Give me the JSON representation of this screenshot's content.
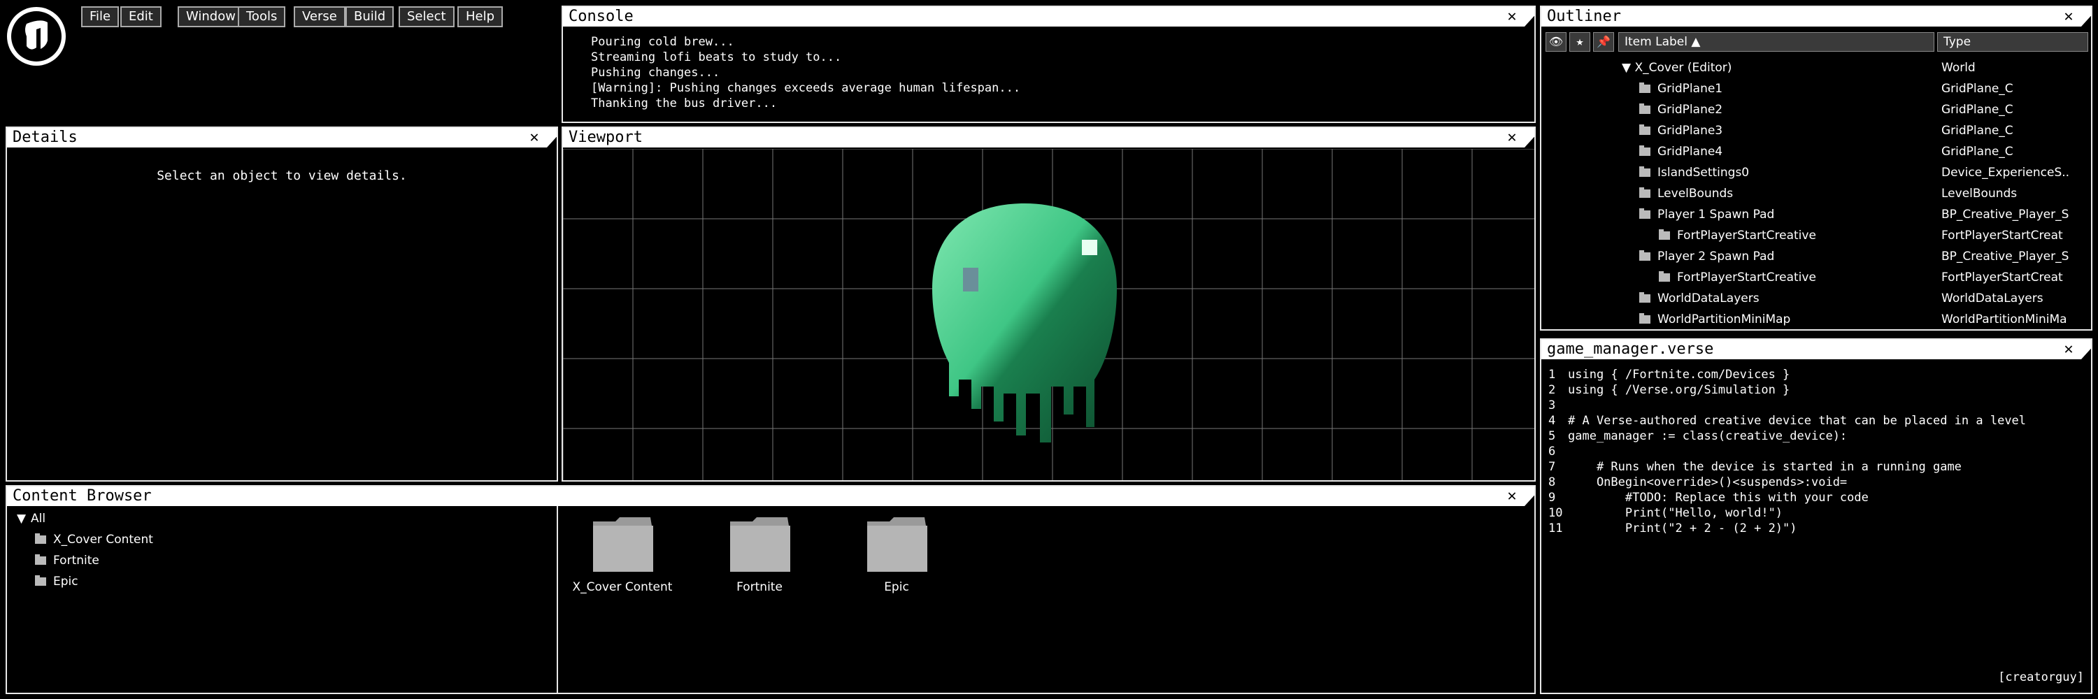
{
  "menu": [
    "File",
    "Edit",
    "Window",
    "Tools",
    "Verse",
    "Build",
    "Select",
    "Help"
  ],
  "console": {
    "title": "Console",
    "lines": [
      "Pouring cold brew...",
      "Streaming lofi beats to study to...",
      "Pushing changes...",
      "[Warning]: Pushing changes exceeds average human lifespan...",
      "Thanking the bus driver..."
    ]
  },
  "details": {
    "title": "Details",
    "empty_text": "Select an object to view details."
  },
  "viewport": {
    "title": "Viewport"
  },
  "outliner": {
    "title": "Outliner",
    "col_label": "Item Label ▲",
    "col_type": "Type",
    "rows": [
      {
        "label": "X_Cover (Editor)",
        "type": "World",
        "indent": 0,
        "expand": true
      },
      {
        "label": "GridPlane1",
        "type": "GridPlane_C",
        "indent": 1
      },
      {
        "label": "GridPlane2",
        "type": "GridPlane_C",
        "indent": 1
      },
      {
        "label": "GridPlane3",
        "type": "GridPlane_C",
        "indent": 1
      },
      {
        "label": "GridPlane4",
        "type": "GridPlane_C",
        "indent": 1
      },
      {
        "label": "IslandSettings0",
        "type": "Device_ExperienceS..",
        "indent": 1
      },
      {
        "label": "LevelBounds",
        "type": "LevelBounds",
        "indent": 1
      },
      {
        "label": "Player 1 Spawn Pad",
        "type": "BP_Creative_Player_S",
        "indent": 1
      },
      {
        "label": "FortPlayerStartCreative",
        "type": "FortPlayerStartCreat",
        "indent": 2
      },
      {
        "label": "Player 2 Spawn Pad",
        "type": "BP_Creative_Player_S",
        "indent": 1
      },
      {
        "label": "FortPlayerStartCreative",
        "type": "FortPlayerStartCreat",
        "indent": 2
      },
      {
        "label": "WorldDataLayers",
        "type": "WorldDataLayers",
        "indent": 1
      },
      {
        "label": "WorldPartitionMiniMap",
        "type": "WorldPartitionMiniMa",
        "indent": 1
      }
    ]
  },
  "editor": {
    "title": "game_manager.verse",
    "lines": [
      {
        "n": "1",
        "code": "using { /Fortnite.com/Devices }"
      },
      {
        "n": "2",
        "code": "using { /Verse.org/Simulation }"
      },
      {
        "n": "3",
        "code": ""
      },
      {
        "n": "4",
        "code": "# A Verse-authored creative device that can be placed in a level"
      },
      {
        "n": "5",
        "code": "game_manager := class(creative_device):"
      },
      {
        "n": "6",
        "code": ""
      },
      {
        "n": "7",
        "code": "    # Runs when the device is started in a running game"
      },
      {
        "n": "8",
        "code": "    OnBegin<override>()<suspends>:void="
      },
      {
        "n": "9",
        "code": "        #TODO: Replace this with your code"
      },
      {
        "n": "10",
        "code": "        Print(\"Hello, world!\")"
      },
      {
        "n": "11",
        "code": "        Print(\"2 + 2 - (2 + 2)\")"
      }
    ],
    "signature": "[creatorguy]"
  },
  "content": {
    "title": "Content Browser",
    "tree_root": "All",
    "tree": [
      "X_Cover Content",
      "Fortnite",
      "Epic"
    ],
    "folders": [
      "X_Cover Content",
      "Fortnite",
      "Epic"
    ]
  }
}
